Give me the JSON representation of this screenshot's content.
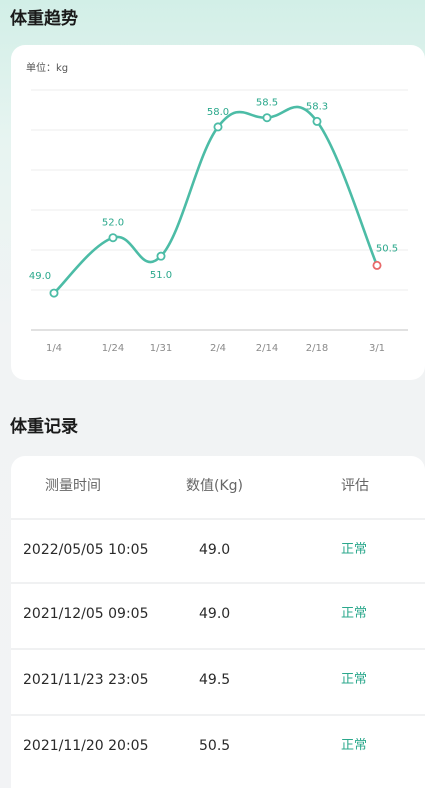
{
  "trend": {
    "title": "体重趋势",
    "unit_label": "单位：kg"
  },
  "records": {
    "title": "体重记录",
    "headers": {
      "time": "测量时间",
      "value": "数值(Kg)",
      "evaluation": "评估"
    },
    "rows": [
      {
        "time": "2022/05/05 10:05",
        "value": "49.0",
        "evaluation": "正常"
      },
      {
        "time": "2021/12/05 09:05",
        "value": "49.0",
        "evaluation": "正常"
      },
      {
        "time": "2021/11/23 23:05",
        "value": "49.5",
        "evaluation": "正常"
      },
      {
        "time": "2021/11/20 20:05",
        "value": "50.5",
        "evaluation": "正常"
      }
    ]
  },
  "colors": {
    "line": "#4cbca6",
    "last_point": "#e86a6a",
    "status_normal": "#2ba88c",
    "data_label": "#2ba88c"
  },
  "chart_data": {
    "type": "line",
    "categories": [
      "1/4",
      "1/24",
      "1/31",
      "2/4",
      "2/14",
      "2/18",
      "3/1"
    ],
    "values": [
      49.0,
      52.0,
      51.0,
      58.0,
      58.5,
      58.3,
      50.5
    ],
    "labels": [
      "49.0",
      "52.0",
      "51.0",
      "58.0",
      "58.5",
      "58.3",
      "50.5"
    ],
    "ylim": [
      47.0,
      60.0
    ],
    "grid": true,
    "smooth": true,
    "highlight_last_point": true
  }
}
